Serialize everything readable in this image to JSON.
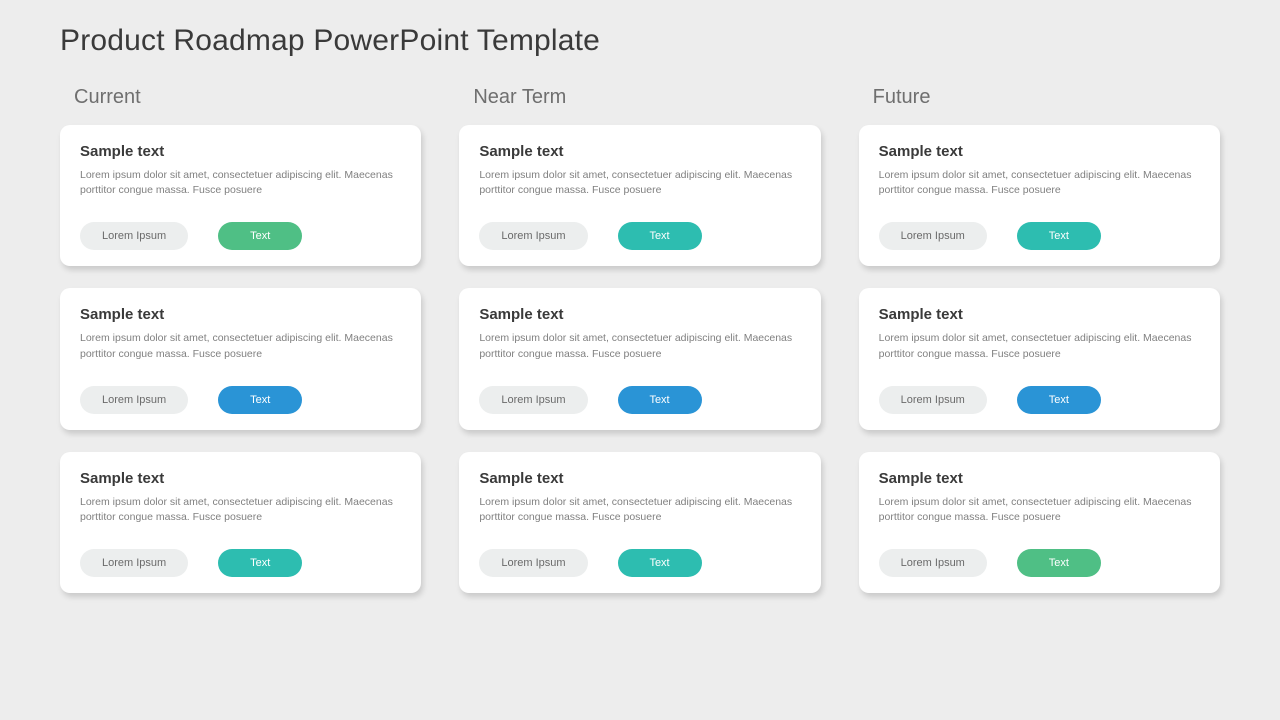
{
  "title": "Product Roadmap PowerPoint Template",
  "colors": {
    "green": "#4fbf85",
    "teal": "#2dbdb0",
    "blue": "#2a94d6"
  },
  "columns": [
    {
      "header": "Current",
      "cards": [
        {
          "title": "Sample text",
          "body": "Lorem ipsum dolor sit amet, consectetuer adipiscing elit. Maecenas porttitor congue massa. Fusce posuere",
          "pill1": "Lorem Ipsum",
          "pill2": "Text",
          "color": "green"
        },
        {
          "title": "Sample text",
          "body": "Lorem ipsum dolor sit amet, consectetuer adipiscing elit. Maecenas porttitor congue massa. Fusce posuere",
          "pill1": "Lorem Ipsum",
          "pill2": "Text",
          "color": "blue"
        },
        {
          "title": "Sample text",
          "body": "Lorem ipsum dolor sit amet, consectetuer adipiscing elit. Maecenas porttitor congue massa. Fusce posuere",
          "pill1": "Lorem Ipsum",
          "pill2": "Text",
          "color": "teal"
        }
      ]
    },
    {
      "header": "Near Term",
      "cards": [
        {
          "title": "Sample text",
          "body": "Lorem ipsum dolor sit amet, consectetuer adipiscing elit. Maecenas porttitor congue massa. Fusce posuere",
          "pill1": "Lorem Ipsum",
          "pill2": "Text",
          "color": "teal"
        },
        {
          "title": "Sample text",
          "body": "Lorem ipsum dolor sit amet, consectetuer adipiscing elit. Maecenas porttitor congue massa. Fusce posuere",
          "pill1": "Lorem Ipsum",
          "pill2": "Text",
          "color": "blue"
        },
        {
          "title": "Sample text",
          "body": "Lorem ipsum dolor sit amet, consectetuer adipiscing elit. Maecenas porttitor congue massa. Fusce posuere",
          "pill1": "Lorem Ipsum",
          "pill2": "Text",
          "color": "teal"
        }
      ]
    },
    {
      "header": "Future",
      "cards": [
        {
          "title": "Sample text",
          "body": "Lorem ipsum dolor sit amet, consectetuer adipiscing elit. Maecenas porttitor congue massa. Fusce posuere",
          "pill1": "Lorem Ipsum",
          "pill2": "Text",
          "color": "teal"
        },
        {
          "title": "Sample text",
          "body": "Lorem ipsum dolor sit amet, consectetuer adipiscing elit. Maecenas porttitor congue massa. Fusce posuere",
          "pill1": "Lorem Ipsum",
          "pill2": "Text",
          "color": "blue"
        },
        {
          "title": "Sample text",
          "body": "Lorem ipsum dolor sit amet, consectetuer adipiscing elit. Maecenas porttitor congue massa. Fusce posuere",
          "pill1": "Lorem Ipsum",
          "pill2": "Text",
          "color": "green"
        }
      ]
    }
  ]
}
